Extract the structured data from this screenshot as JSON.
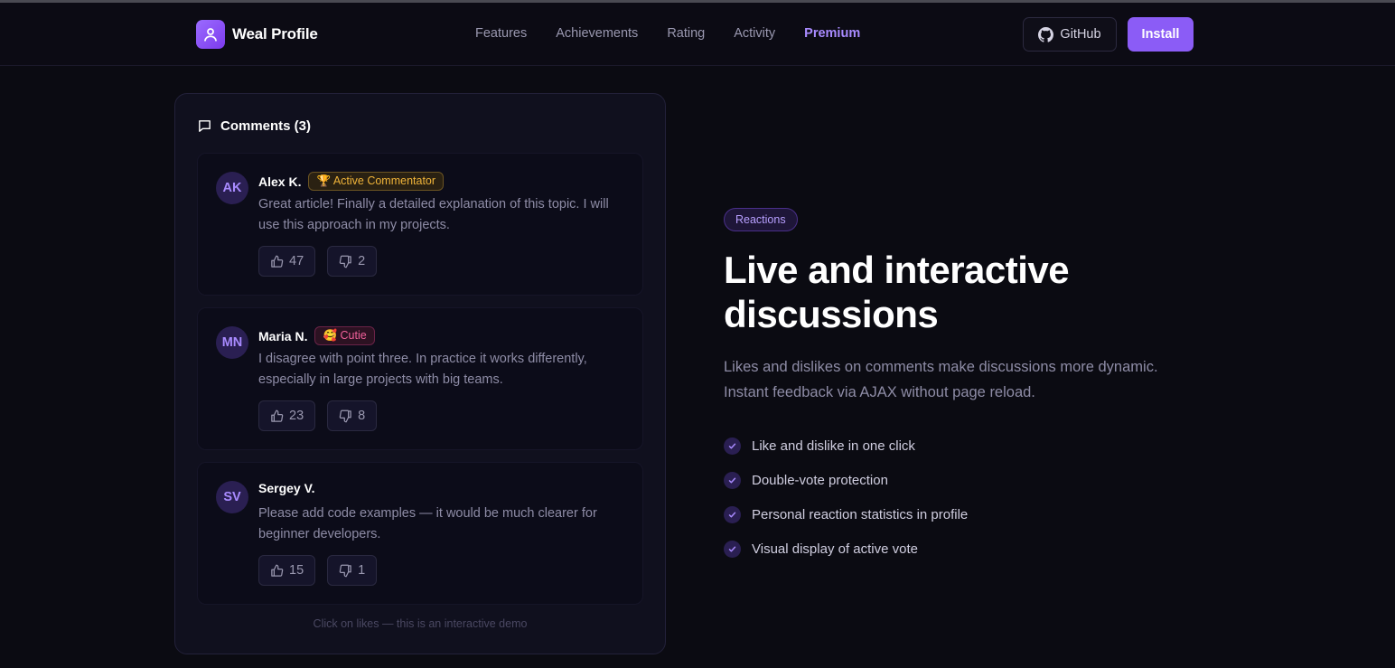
{
  "header": {
    "brand_name": "Weal Profile",
    "nav": [
      "Features",
      "Achievements",
      "Rating",
      "Activity",
      "Premium"
    ],
    "active_nav": "Premium",
    "github_label": "GitHub",
    "install_label": "Install"
  },
  "comments_panel": {
    "title": "Comments (3)",
    "items": [
      {
        "initials": "AK",
        "name": "Alex K.",
        "badge": "🏆 Active Commentator",
        "text": "Great article! Finally a detailed explanation of this topic. I will use this approach in my projects.",
        "likes": "47",
        "dislikes": "2"
      },
      {
        "initials": "MN",
        "name": "Maria N.",
        "badge": "🥰 Cutie",
        "text": "I disagree with point three. In practice it works differently, especially in large projects with big teams.",
        "likes": "23",
        "dislikes": "8"
      },
      {
        "initials": "SV",
        "name": "Sergey V.",
        "badge": "",
        "text": "Please add code examples — it would be much clearer for beginner developers.",
        "likes": "15",
        "dislikes": "1"
      }
    ],
    "note": "Click on likes — this is an interactive demo"
  },
  "hero": {
    "tag": "Reactions",
    "headline_line1": "Live and interactive",
    "headline_line2": "discussions",
    "subtitle": "Likes and dislikes on comments make discussions more dynamic. Instant feedback via AJAX without page reload.",
    "features": [
      "Like and dislike in one click",
      "Double-vote protection",
      "Personal reaction statistics in profile",
      "Visual display of active vote"
    ]
  },
  "colors": {
    "accent": "#8b5cf6",
    "background": "#0b0b12",
    "badge_gold": "#f0b43a",
    "badge_pink": "#f0609a"
  }
}
